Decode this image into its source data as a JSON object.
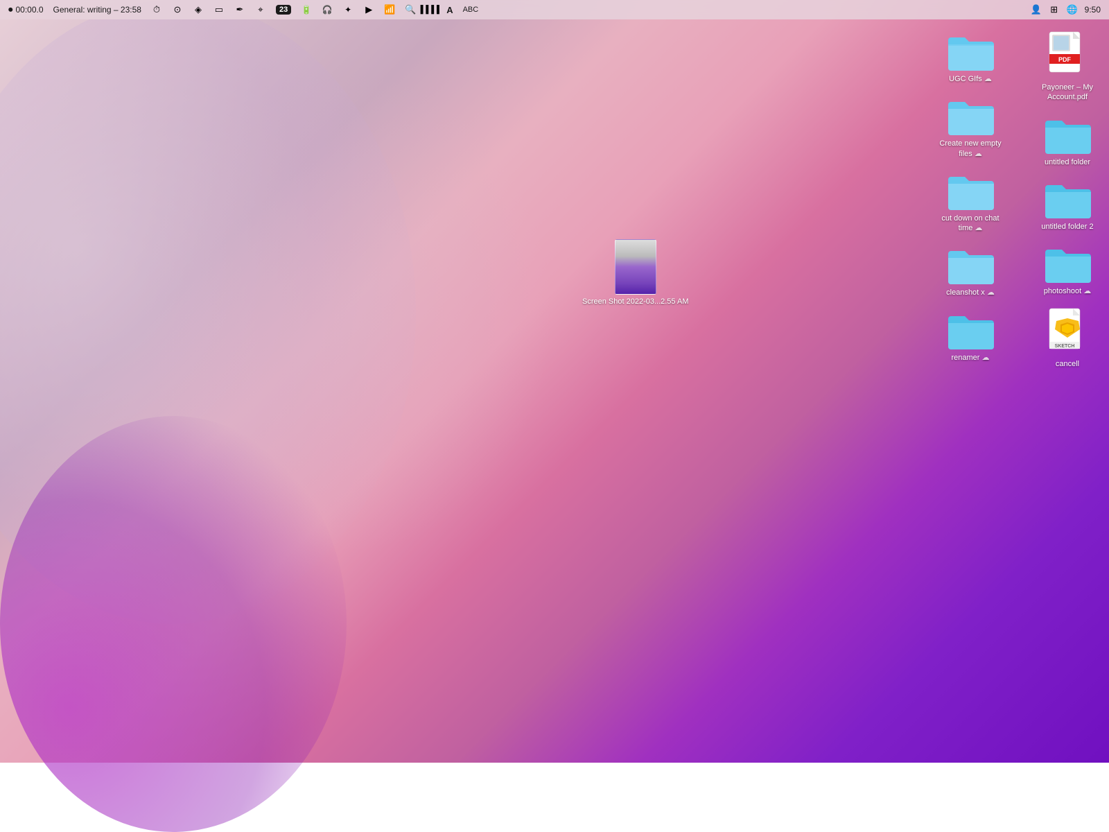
{
  "menubar": {
    "recording_time": "00:00.0",
    "general_writing": "General: writing – 23:58",
    "time": "9:50"
  },
  "desktop": {
    "right_column": [
      {
        "id": "ugc-gifs",
        "label": "UGC GIfs",
        "type": "folder",
        "has_cloud": true
      },
      {
        "id": "create-new-empty-files",
        "label": "Create new empty files",
        "type": "folder",
        "has_cloud": true
      },
      {
        "id": "cut-down-on-chat-time",
        "label": "cut down on chat time",
        "type": "folder",
        "has_cloud": true
      },
      {
        "id": "cleanshot-x",
        "label": "cleanshot x",
        "type": "folder",
        "has_cloud": true
      },
      {
        "id": "renamer",
        "label": "renamer",
        "type": "folder",
        "has_cloud": true
      }
    ],
    "far_right_column": [
      {
        "id": "payoneer-pdf",
        "label": "Payoneer – My Account.pdf",
        "type": "pdf"
      },
      {
        "id": "untitled-folder",
        "label": "untitled folder",
        "type": "folder",
        "has_cloud": false
      },
      {
        "id": "untitled-folder-2",
        "label": "untitled folder 2",
        "type": "folder",
        "has_cloud": false
      },
      {
        "id": "photoshoot",
        "label": "photoshoot",
        "type": "folder",
        "has_cloud": true
      },
      {
        "id": "cancell-sketch",
        "label": "cancell",
        "type": "sketch"
      }
    ],
    "screenshot": {
      "label": "Screen Shot 2022-03...2.55 AM",
      "type": "screenshot"
    }
  }
}
